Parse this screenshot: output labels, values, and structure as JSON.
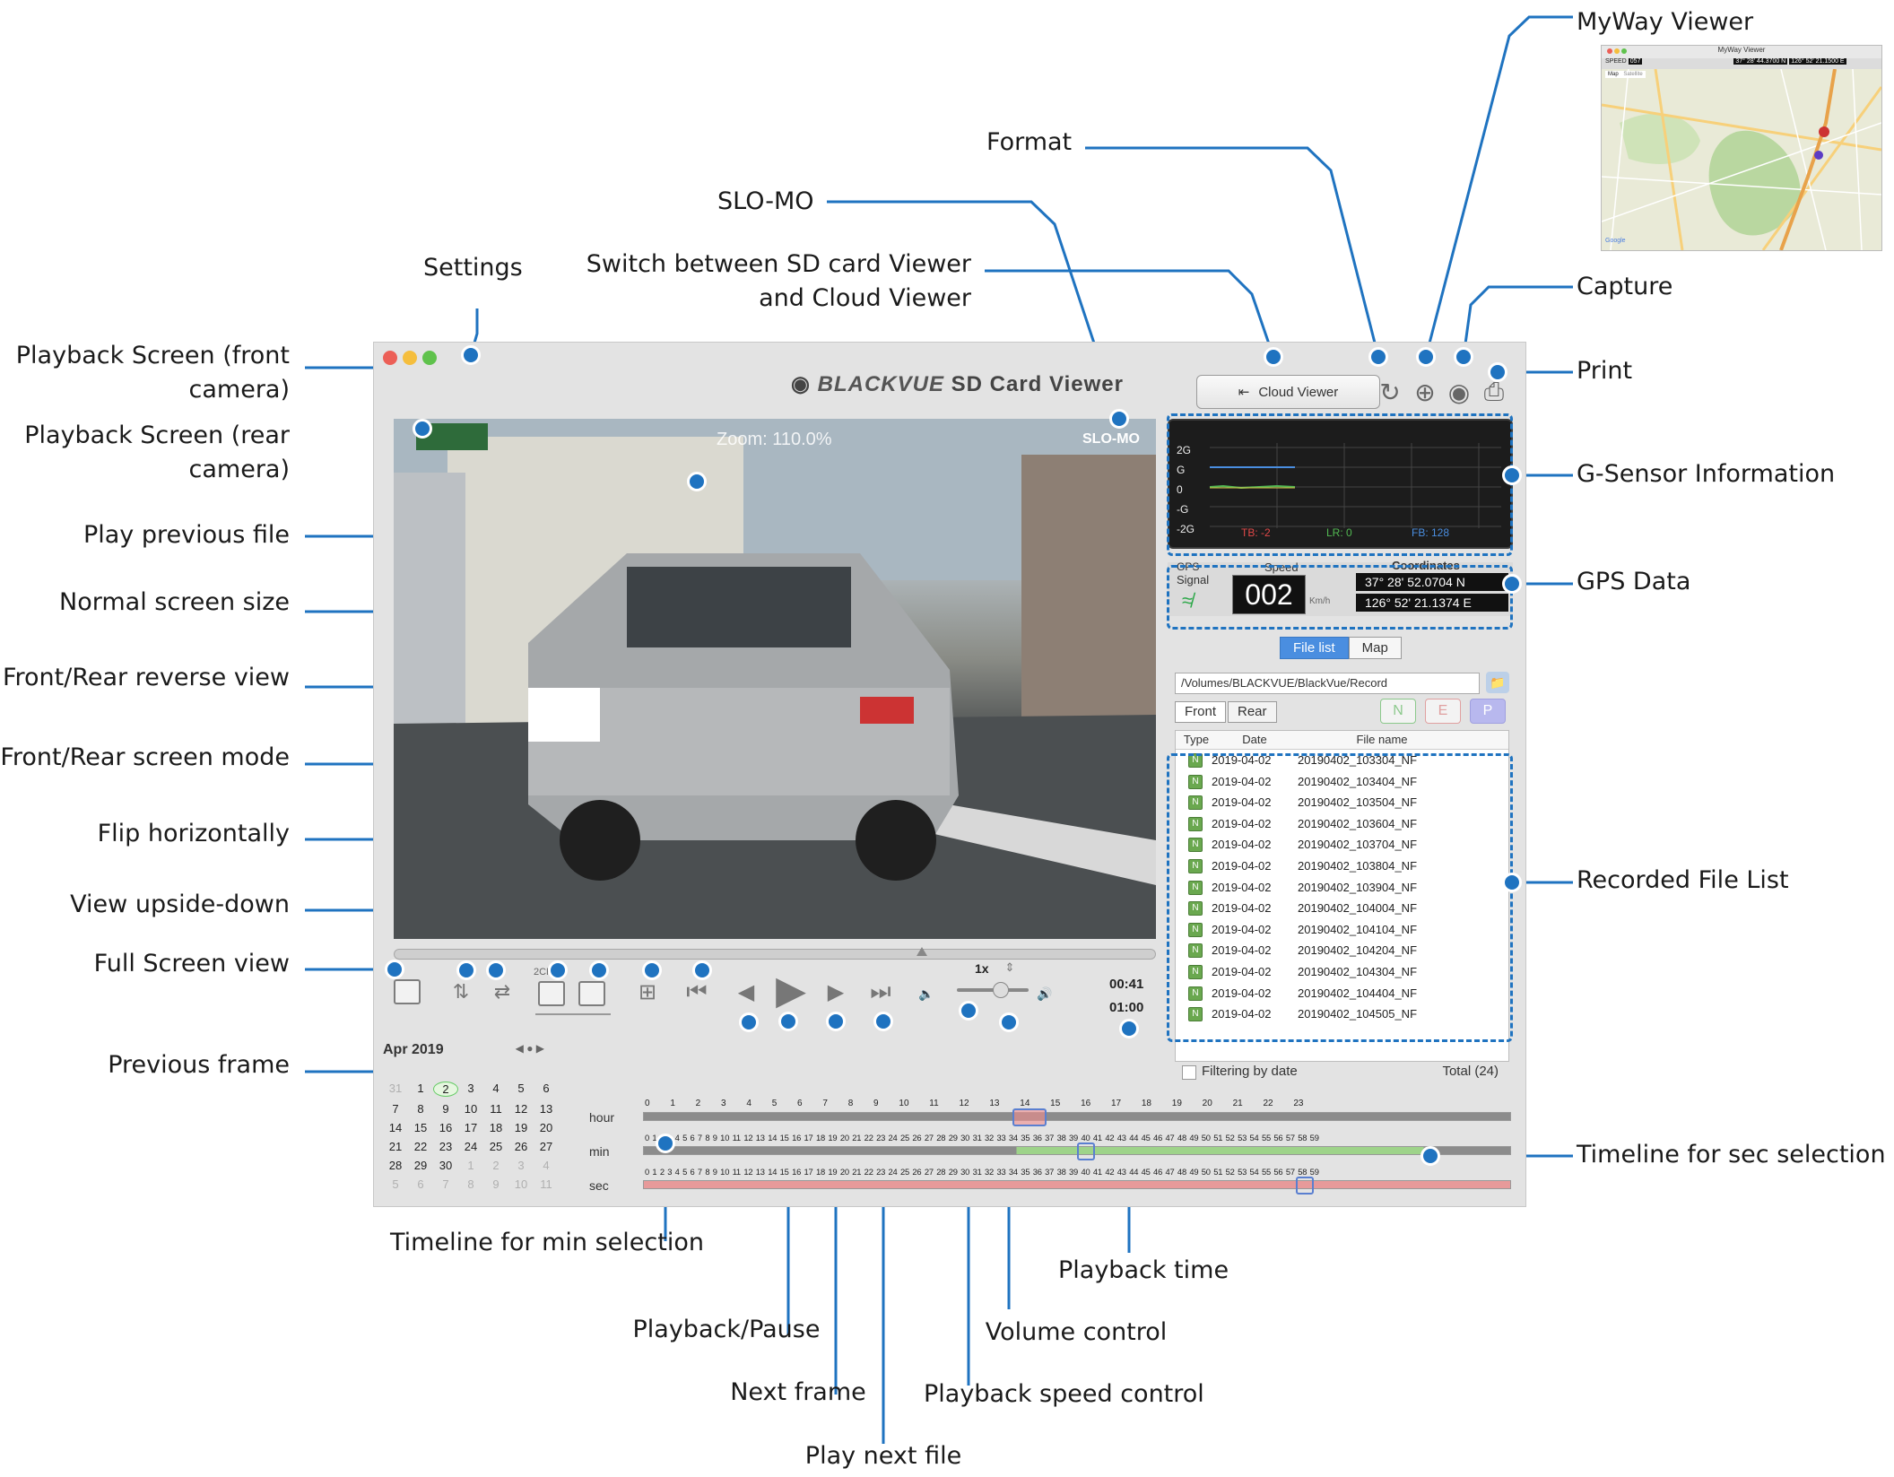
{
  "annotations": {
    "myway_viewer": "MyWay Viewer",
    "format": "Format",
    "slomo": "SLO-MO",
    "switch_viewer_line1": "Switch between SD card Viewer",
    "switch_viewer_line2": "and Cloud Viewer",
    "settings": "Settings",
    "capture": "Capture",
    "print": "Print",
    "playback_front_line1": "Playback Screen (front",
    "playback_front_line2": "camera)",
    "playback_rear_line1": "Playback Screen (rear",
    "playback_rear_line2": "camera)",
    "play_previous_file": "Play previous file",
    "normal_screen_size": "Normal screen size",
    "front_rear_reverse": "Front/Rear reverse view",
    "front_rear_mode": "Front/Rear screen mode",
    "flip_horizontally": "Flip horizontally",
    "view_upside_down": "View upside-down",
    "full_screen_view": "Full Screen view",
    "previous_frame": "Previous frame",
    "g_sensor_info": "G-Sensor Information",
    "gps_data": "GPS Data",
    "recorded_file_list": "Recorded File List",
    "timeline_sec": "Timeline for sec selection",
    "timeline_min": "Timeline for min selection",
    "playback_pause": "Playback/Pause",
    "next_frame": "Next frame",
    "play_next_file": "Play next file",
    "playback_speed": "Playback speed control",
    "volume_control": "Volume control",
    "playback_time": "Playback time"
  },
  "app": {
    "brand_name": "BLACKVUE",
    "brand_suffix": "SD Card Viewer",
    "cloud_button": "Cloud Viewer",
    "zoom_text": "Zoom: 110.0%",
    "slomo_badge": "SLO-MO",
    "speed_label": "1x",
    "time_current": "00:41",
    "time_total": "01:00",
    "switch_label": "2CH"
  },
  "gsensor": {
    "y_labels": [
      "2G",
      "G",
      "0",
      "-G",
      "-2G"
    ],
    "tb": "TB: -2",
    "lr": "LR: 0",
    "fb": "FB: 128",
    "colors": {
      "tb": "#e04848",
      "lr": "#52b852",
      "fb": "#4a8ee0"
    }
  },
  "gps": {
    "gps_label": "GPS",
    "signal_label": "Signal",
    "speed_header": "Speed",
    "speed_value": "002",
    "speed_unit": "Km/h",
    "coords_header": "Coordinates",
    "lat": "37° 28' 52.0704 N",
    "lon": "126° 52' 21.1374 E"
  },
  "file_panel": {
    "tab_file_list": "File list",
    "tab_map": "Map",
    "path": "/Volumes/BLACKVUE/BlackVue/Record",
    "front_tab": "Front",
    "rear_tab": "Rear",
    "filter_n": "N",
    "filter_e": "E",
    "filter_p": "P",
    "col_type": "Type",
    "col_date": "Date",
    "col_filename": "File name",
    "rows": [
      {
        "date": "2019-04-02",
        "name": "20190402_103304_NF"
      },
      {
        "date": "2019-04-02",
        "name": "20190402_103404_NF"
      },
      {
        "date": "2019-04-02",
        "name": "20190402_103504_NF"
      },
      {
        "date": "2019-04-02",
        "name": "20190402_103604_NF"
      },
      {
        "date": "2019-04-02",
        "name": "20190402_103704_NF"
      },
      {
        "date": "2019-04-02",
        "name": "20190402_103804_NF"
      },
      {
        "date": "2019-04-02",
        "name": "20190402_103904_NF"
      },
      {
        "date": "2019-04-02",
        "name": "20190402_104004_NF"
      },
      {
        "date": "2019-04-02",
        "name": "20190402_104104_NF"
      },
      {
        "date": "2019-04-02",
        "name": "20190402_104204_NF"
      },
      {
        "date": "2019-04-02",
        "name": "20190402_104304_NF"
      },
      {
        "date": "2019-04-02",
        "name": "20190402_104404_NF"
      },
      {
        "date": "2019-04-02",
        "name": "20190402_104505_NF"
      }
    ],
    "filtering_label": "Filtering by date",
    "total": "Total (24)"
  },
  "calendar": {
    "month": "Apr 2019",
    "days": [
      "31",
      "1",
      "2",
      "3",
      "4",
      "5",
      "6",
      "7",
      "8",
      "9",
      "10",
      "11",
      "12",
      "13",
      "14",
      "15",
      "16",
      "17",
      "18",
      "19",
      "20",
      "21",
      "22",
      "23",
      "24",
      "25",
      "26",
      "27",
      "28",
      "29",
      "30",
      "1",
      "2",
      "3",
      "4",
      "5",
      "6",
      "7",
      "8",
      "9",
      "10",
      "11"
    ]
  },
  "timeline": {
    "hour_label": "hour",
    "min_label": "min",
    "sec_label": "sec",
    "hour_numbers": "0  1  2  3  4  5  6  7  8  9  10  11  12  13  14  15  16  17  18  19  20  21  22  23",
    "minsec_numbers": "0 1 2 3 4 5 6 7 8 9 10 11 12 13 14 15 16 17 18 19 20 21 22 23 24 25 26 27 28 29 30 31 32 33 34 35 36 37 38 39 40 41 42 43 44 45 46 47 48 49 50 51 52 53 54 55 56 57 58 59"
  },
  "myway": {
    "title": "MyWay Viewer",
    "speed_tag": "SPEED",
    "speed_val": "057",
    "tab_map": "Map",
    "tab_satellite": "Satellite",
    "lat": "37° 28' 44.3700 N",
    "lon": "126° 52' 21.1500 E",
    "google": "Google"
  }
}
